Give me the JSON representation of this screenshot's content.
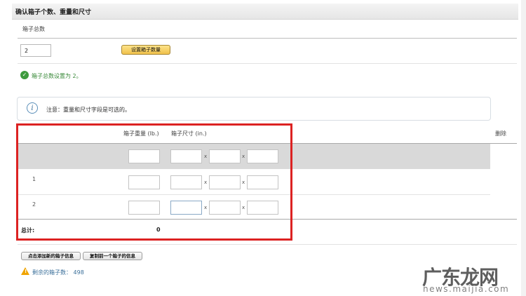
{
  "header": {
    "title": "确认箱子个数、重量和尺寸"
  },
  "box_count": {
    "label": "箱子总数",
    "value": "2",
    "set_button": "设置箱子数量",
    "success_message": "箱子总数设置为 2。"
  },
  "notice": {
    "text": "注意：重量和尺寸字段是可选的。"
  },
  "table": {
    "headers": {
      "weight": "箱子重量 (lb.)",
      "dimensions": "箱子尺寸 (in.)",
      "delete": "删除"
    },
    "separator": "x",
    "rows": [
      {
        "label": ""
      },
      {
        "label": "1"
      },
      {
        "label": "2"
      }
    ],
    "total_label": "总计:",
    "total_value": "0"
  },
  "actions": {
    "add_box_info": "点击添加新的箱子信息",
    "copy_prev_box": "复制前一个箱子的信息"
  },
  "remaining": {
    "text": "剩余的箱子数： 498"
  },
  "watermark": {
    "text": "广东龙网",
    "url": "news.maijia.com"
  },
  "colors": {
    "highlight": "#dc2222",
    "button_yellow": "#f0c14b",
    "success": "#3e9b3e",
    "link_blue": "#3a6f9a"
  },
  "icons": {
    "success": "check-circle-icon",
    "info": "info-circle-icon",
    "warning": "warning-triangle-icon"
  }
}
